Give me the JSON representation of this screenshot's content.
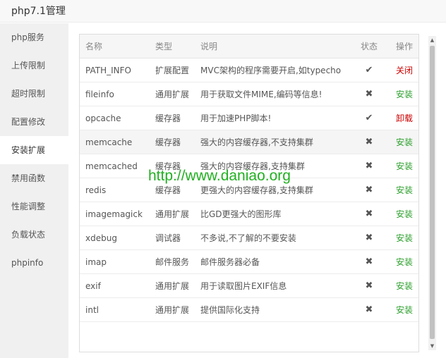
{
  "window": {
    "title": "php7.1管理"
  },
  "sidebar": {
    "items": [
      {
        "label": "php服务",
        "active": false
      },
      {
        "label": "上传限制",
        "active": false
      },
      {
        "label": "超时限制",
        "active": false
      },
      {
        "label": "配置修改",
        "active": false
      },
      {
        "label": "安装扩展",
        "active": true
      },
      {
        "label": "禁用函数",
        "active": false
      },
      {
        "label": "性能调整",
        "active": false
      },
      {
        "label": "负载状态",
        "active": false
      },
      {
        "label": "phpinfo",
        "active": false
      }
    ]
  },
  "table": {
    "headers": {
      "name": "名称",
      "type": "类型",
      "desc": "说明",
      "status": "状态",
      "op": "操作"
    },
    "rows": [
      {
        "name": "PATH_INFO",
        "type": "扩展配置",
        "desc": "MVC架构的程序需要开启,如typecho",
        "status": "✔",
        "op": "关闭",
        "op_color": "red"
      },
      {
        "name": "fileinfo",
        "type": "通用扩展",
        "desc": "用于获取文件MIME,编码等信息!",
        "status": "✖",
        "op": "安装",
        "op_color": "green"
      },
      {
        "name": "opcache",
        "type": "缓存器",
        "desc": "用于加速PHP脚本!",
        "status": "✔",
        "op": "卸载",
        "op_color": "red"
      },
      {
        "name": "memcache",
        "type": "缓存器",
        "desc": "强大的内容缓存器,不支持集群",
        "status": "✖",
        "op": "安装",
        "op_color": "green"
      },
      {
        "name": "memcached",
        "type": "缓存器",
        "desc": "强大的内容缓存器,支持集群",
        "status": "✖",
        "op": "安装",
        "op_color": "green"
      },
      {
        "name": "redis",
        "type": "缓存器",
        "desc": "更强大的内容缓存器,支持集群",
        "status": "✖",
        "op": "安装",
        "op_color": "green"
      },
      {
        "name": "imagemagick",
        "type": "通用扩展",
        "desc": "比GD更强大的图形库",
        "status": "✖",
        "op": "安装",
        "op_color": "green"
      },
      {
        "name": "xdebug",
        "type": "调试器",
        "desc": "不多说,不了解的不要安装",
        "status": "✖",
        "op": "安装",
        "op_color": "green"
      },
      {
        "name": "imap",
        "type": "邮件服务",
        "desc": "邮件服务器必备",
        "status": "✖",
        "op": "安装",
        "op_color": "green"
      },
      {
        "name": "exif",
        "type": "通用扩展",
        "desc": "用于读取图片EXIF信息",
        "status": "✖",
        "op": "安装",
        "op_color": "green"
      },
      {
        "name": "intl",
        "type": "通用扩展",
        "desc": "提供国际化支持",
        "status": "✖",
        "op": "安装",
        "op_color": "green"
      }
    ]
  },
  "watermark": "http://www.daniao.org",
  "icons": {
    "installed": "check-icon",
    "not_installed": "cross-icon",
    "scroll_up": "triangle-up-icon",
    "scroll_down": "triangle-down-icon"
  },
  "colors": {
    "action_red": "#cc0000",
    "action_green": "#2e9f2e",
    "watermark": "#22b022"
  }
}
